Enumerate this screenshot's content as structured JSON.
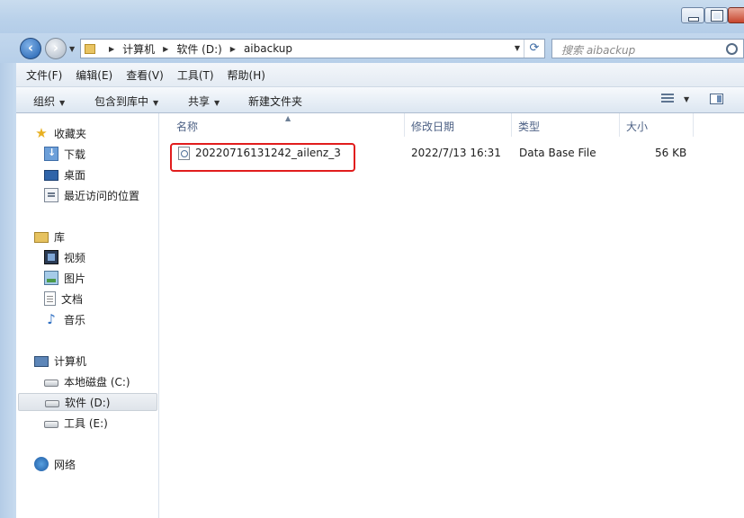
{
  "window": {
    "title": "aibackup"
  },
  "address": {
    "crumbs": [
      "计算机",
      "软件 (D:)",
      "aibackup"
    ]
  },
  "search": {
    "placeholder": "搜索 aibackup"
  },
  "menu": [
    "文件(F)",
    "编辑(E)",
    "查看(V)",
    "工具(T)",
    "帮助(H)"
  ],
  "toolbar": {
    "organize": "组织",
    "include": "包含到库中",
    "share": "共享",
    "new_folder": "新建文件夹"
  },
  "sidebar": {
    "favorites": "收藏夹",
    "downloads": "下载",
    "desktop": "桌面",
    "recent": "最近访问的位置",
    "libraries": "库",
    "videos": "视频",
    "pictures": "图片",
    "documents": "文档",
    "music": "音乐",
    "computer": "计算机",
    "drive_c": "本地磁盘 (C:)",
    "drive_d": "软件 (D:)",
    "drive_e": "工具 (E:)",
    "network": "网络"
  },
  "columns": {
    "name": "名称",
    "modified": "修改日期",
    "type": "类型",
    "size": "大小"
  },
  "files": [
    {
      "name": "20220716131242_ailenz_3",
      "modified": "2022/7/13 16:31",
      "type": "Data Base File",
      "size": "56 KB"
    }
  ],
  "colors": {
    "highlight": "#e11d1d",
    "accent": "#3b6aa3"
  }
}
